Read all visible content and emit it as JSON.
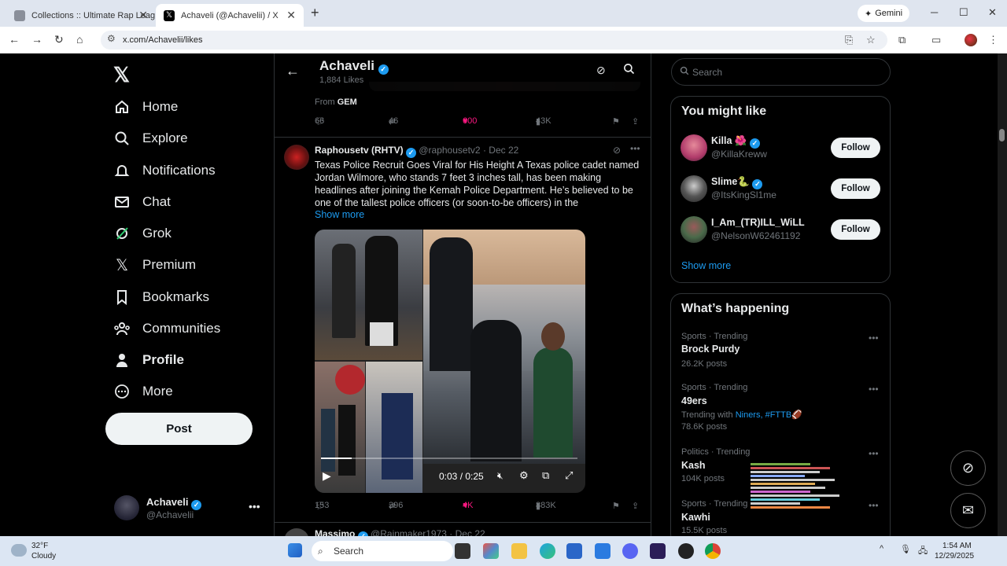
{
  "browser": {
    "tabs": [
      {
        "title": "Collections :: Ultimate Rap Leag",
        "active": false
      },
      {
        "title": "Achaveli (@Achavelii) / X",
        "active": true
      }
    ],
    "gemini_label": "Gemini",
    "url": "x.com/Achavelii/likes"
  },
  "nav": {
    "items": [
      {
        "label": "Home",
        "icon": "home-icon"
      },
      {
        "label": "Explore",
        "icon": "search-icon"
      },
      {
        "label": "Notifications",
        "icon": "bell-icon"
      },
      {
        "label": "Chat",
        "icon": "mail-icon"
      },
      {
        "label": "Grok",
        "icon": "grok-icon"
      },
      {
        "label": "Premium",
        "icon": "x-icon"
      },
      {
        "label": "Bookmarks",
        "icon": "bookmark-icon"
      },
      {
        "label": "Communities",
        "icon": "people-icon"
      },
      {
        "label": "Profile",
        "icon": "person-icon"
      },
      {
        "label": "More",
        "icon": "more-circle-icon"
      }
    ],
    "post_label": "Post",
    "account": {
      "name": "Achaveli",
      "handle": "@Achavelii"
    }
  },
  "header": {
    "name": "Achaveli",
    "count": "1,884 Likes"
  },
  "tweet1": {
    "from_prefix": "From",
    "from_source": "GEM",
    "replies": "66",
    "reposts": "46",
    "likes": "600",
    "views": "43K"
  },
  "tweet2": {
    "name": "Raphousetv (RHTV)",
    "handle": "@raphousetv2",
    "date": "Dec 22",
    "text": "Texas Police Recruit Goes Viral for His Height A Texas police cadet named Jordan Wilmore, who stands 7 feet 3 inches tall, has been making headlines after joining the Kemah Police Department. He’s believed to be one of the tallest police officers (or soon-to-be officers) in the",
    "show_more": "Show more",
    "video_time": "0:03 / 0:25",
    "video_progress": 0.12,
    "replies": "153",
    "reposts": "396",
    "likes": "4K",
    "views": "883K"
  },
  "tweet3": {
    "name": "Massimo",
    "handle": "@Rainmaker1973",
    "date": "Dec 22"
  },
  "right": {
    "search_placeholder": "Search",
    "you_might_like": "You might like",
    "suggestions": [
      {
        "name": "Killa 🌺",
        "handle": "@KillaKreww",
        "follow": "Follow"
      },
      {
        "name": "Slime🐍",
        "handle": "@ItsKingSl1me",
        "follow": "Follow"
      },
      {
        "name": "I_Am_(TR)ILL_WiLL",
        "handle": "@NelsonW62461192",
        "follow": "Follow"
      }
    ],
    "show_more": "Show more",
    "whats_happening": "What’s happening",
    "trends": [
      {
        "category": "Sports · Trending",
        "name": "Brock Purdy",
        "posts": "26.2K posts"
      },
      {
        "category": "Sports · Trending",
        "name": "49ers",
        "with_prefix": "Trending with",
        "with": "Niners, #FTTB🏈",
        "posts": "78.6K posts"
      },
      {
        "category": "Politics · Trending",
        "name": "Kash",
        "posts": "104K posts"
      },
      {
        "category": "Sports · Trending",
        "name": "Kawhi",
        "posts": "15.5K posts"
      }
    ]
  },
  "taskbar": {
    "temp": "32°F",
    "condition": "Cloudy",
    "search": "Search",
    "time": "1:54 AM",
    "date": "12/29/2025"
  },
  "colors": {
    "accent": "#1d9bf0",
    "like": "#f91880",
    "bg": "#000000",
    "border": "#2f3336"
  }
}
